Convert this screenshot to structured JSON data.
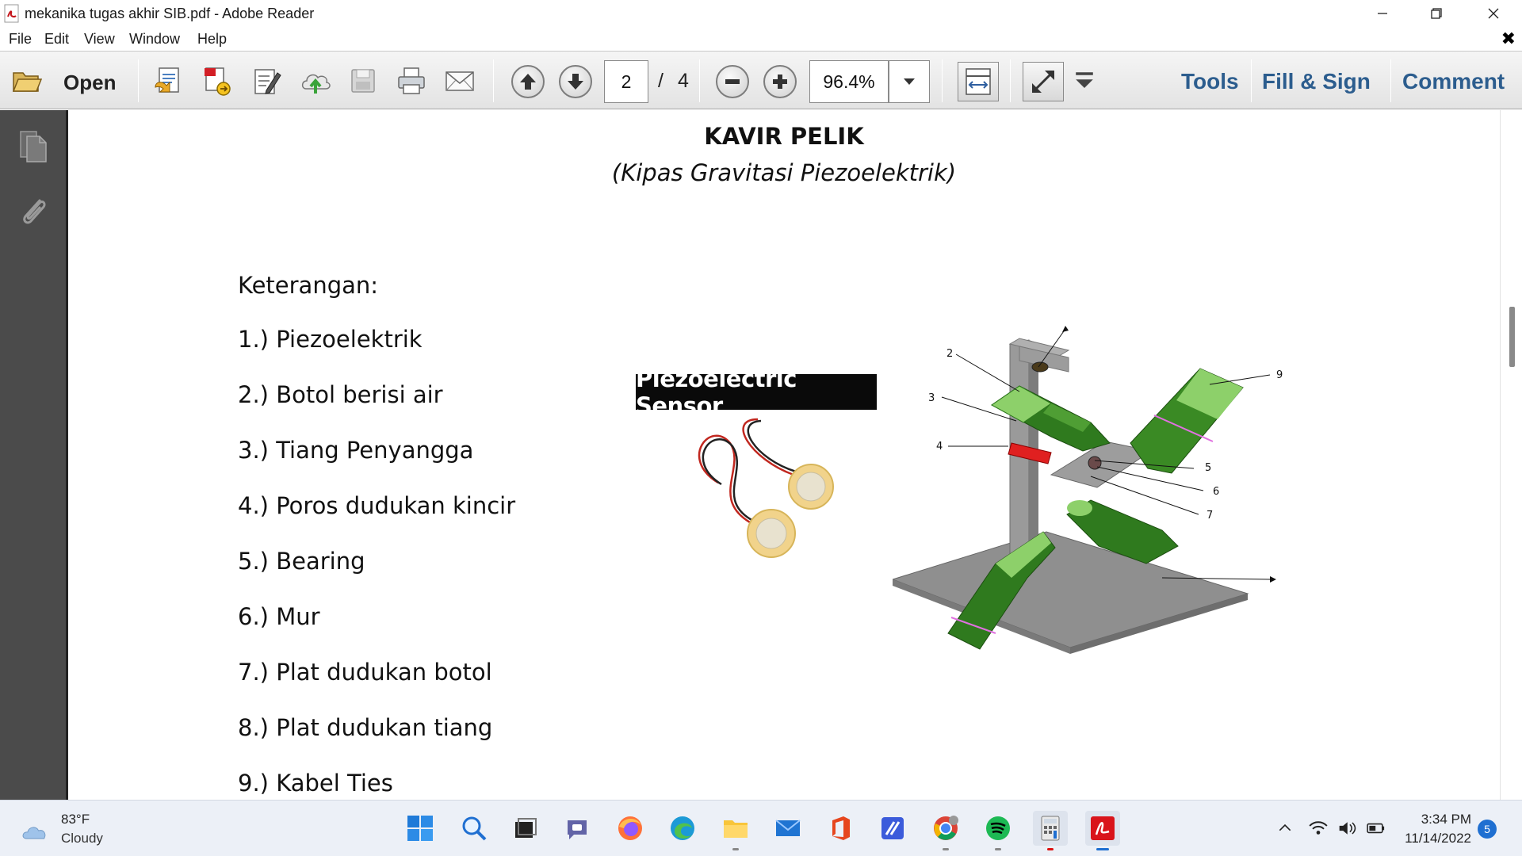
{
  "window": {
    "title": "mekanika tugas akhir SIB.pdf - Adobe Reader",
    "controls": [
      "minimize-icon",
      "restore-icon",
      "close-icon"
    ]
  },
  "menu": {
    "items": [
      "File",
      "Edit",
      "View",
      "Window",
      "Help"
    ],
    "doc_close": "✖"
  },
  "toolbar": {
    "open_label": "Open",
    "icons": [
      "folder-open-icon",
      "create-pdf-icon",
      "export-pdf-icon",
      "edit-pdf-icon",
      "upload-cloud-icon",
      "save-icon",
      "print-icon",
      "email-icon"
    ],
    "current_page": "2",
    "page_separator": "/",
    "total_pages": "4",
    "zoom": "96.4%",
    "tools_label": "Tools",
    "fill_sign_label": "Fill & Sign",
    "comment_label": "Comment"
  },
  "left_panel": {
    "icons": [
      "page-thumbnails-icon",
      "attachment-icon"
    ]
  },
  "document": {
    "title": "KAVIR PELIK",
    "subtitle": "(Kipas Gravitasi Piezoelektrik)",
    "legend_heading": "Keterangan:",
    "legend_items": [
      "1.) Piezoelektrik",
      "2.) Botol berisi air",
      "3.) Tiang Penyangga",
      "4.) Poros dudukan kincir",
      "5.) Bearing",
      "6.) Mur",
      "7.) Plat dudukan botol",
      "8.) Plat dudukan tiang",
      "9.) Kabel Ties"
    ],
    "sensor_banner": "Piezoelectric Sensor",
    "diagram_labels": [
      "2",
      "3",
      "4",
      "5",
      "6",
      "7",
      "9"
    ]
  },
  "taskbar": {
    "weather_temp": "83°F",
    "weather_desc": "Cloudy",
    "apps": [
      "windows-start-icon",
      "search-icon",
      "task-view-icon",
      "chat-icon",
      "firefox-icon",
      "edge-icon",
      "file-explorer-icon",
      "mail-icon",
      "office-icon",
      "app-icon",
      "chrome-icon",
      "spotify-icon",
      "calculator-icon",
      "adobe-reader-icon"
    ],
    "clock_time": "3:34 PM",
    "clock_date": "11/14/2022",
    "notification_count": "5"
  }
}
